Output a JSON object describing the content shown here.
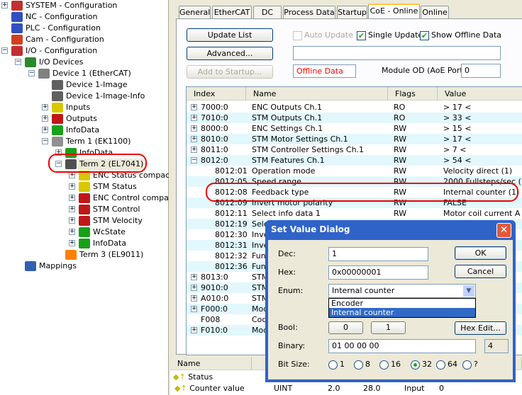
{
  "tree": [
    {
      "label": "SYSTEM - Configuration",
      "level": 0,
      "expander": "+",
      "icon": "system-icon"
    },
    {
      "label": "NC - Configuration",
      "level": 0,
      "expander": "",
      "icon": "nc-icon"
    },
    {
      "label": "PLC - Configuration",
      "level": 0,
      "expander": "",
      "icon": "plc-icon"
    },
    {
      "label": "Cam - Configuration",
      "level": 0,
      "expander": "",
      "icon": "cam-icon"
    },
    {
      "label": "I/O - Configuration",
      "level": 0,
      "expander": "-",
      "icon": "io-icon"
    },
    {
      "label": "I/O Devices",
      "level": 1,
      "expander": "-",
      "icon": "io-devices-icon"
    },
    {
      "label": "Device 1 (EtherCAT)",
      "level": 2,
      "expander": "-",
      "icon": "ethercat-device-icon"
    },
    {
      "label": "Device 1-Image",
      "level": 3,
      "expander": "",
      "icon": "image-icon"
    },
    {
      "label": "Device 1-Image-Info",
      "level": 3,
      "expander": "",
      "icon": "image-icon"
    },
    {
      "label": "Inputs",
      "level": 3,
      "expander": "+",
      "icon": "inputs-icon"
    },
    {
      "label": "Outputs",
      "level": 3,
      "expander": "+",
      "icon": "outputs-icon"
    },
    {
      "label": "InfoData",
      "level": 3,
      "expander": "+",
      "icon": "infodata-icon"
    },
    {
      "label": "Term 1 (EK1100)",
      "level": 3,
      "expander": "-",
      "icon": "coupler-icon"
    },
    {
      "label": "InfoData",
      "level": 4,
      "expander": "+",
      "icon": "infodata-icon"
    },
    {
      "label": "Term 2 (EL7041)",
      "level": 4,
      "expander": "-",
      "icon": "terminal-icon",
      "selected": true
    },
    {
      "label": "ENC Status compact",
      "level": 5,
      "expander": "+",
      "icon": "inputs-icon"
    },
    {
      "label": "STM Status",
      "level": 5,
      "expander": "+",
      "icon": "inputs-icon"
    },
    {
      "label": "ENC Control compact",
      "level": 5,
      "expander": "+",
      "icon": "outputs-icon"
    },
    {
      "label": "STM Control",
      "level": 5,
      "expander": "+",
      "icon": "outputs-icon"
    },
    {
      "label": "STM Velocity",
      "level": 5,
      "expander": "+",
      "icon": "outputs-icon"
    },
    {
      "label": "WcState",
      "level": 5,
      "expander": "+",
      "icon": "infodata-icon"
    },
    {
      "label": "InfoData",
      "level": 5,
      "expander": "+",
      "icon": "infodata-icon"
    },
    {
      "label": "Term 3 (EL9011)",
      "level": 4,
      "expander": "",
      "icon": "end-terminal-icon"
    },
    {
      "label": "Mappings",
      "level": 1,
      "expander": "",
      "icon": "mappings-icon"
    }
  ],
  "tabs": [
    "General",
    "EtherCAT",
    "DC",
    "Process Data",
    "Startup",
    "CoE - Online",
    "Online"
  ],
  "active_tab": "CoE - Online",
  "toolbar": {
    "update_list": "Update List",
    "advanced": "Advanced...",
    "add_to_startup": "Add to Startup...",
    "auto_update": "Auto Update",
    "auto_update_checked": false,
    "single_update": "Single Update",
    "single_update_checked": true,
    "show_offline": "Show Offline Data",
    "show_offline_checked": true,
    "offline_data": "Offline Data",
    "module_od_label": "Module OD (AoE Port):",
    "module_od_value": "0"
  },
  "list": {
    "headers": [
      "Index",
      "Name",
      "Flags",
      "Value"
    ],
    "rows": [
      {
        "exp": "+",
        "index": "7000:0",
        "name": "ENC Outputs Ch.1",
        "flags": "RO",
        "value": "> 17 <"
      },
      {
        "exp": "+",
        "index": "7010:0",
        "name": "STM Outputs Ch.1",
        "flags": "RO",
        "value": "> 33 <"
      },
      {
        "exp": "+",
        "index": "8000:0",
        "name": "ENC Settings Ch.1",
        "flags": "RW",
        "value": "> 15 <"
      },
      {
        "exp": "+",
        "index": "8010:0",
        "name": "STM Motor Settings Ch.1",
        "flags": "RW",
        "value": "> 17 <"
      },
      {
        "exp": "+",
        "index": "8011:0",
        "name": "STM Controller Settings Ch.1",
        "flags": "RW",
        "value": "> 7 <"
      },
      {
        "exp": "-",
        "index": "8012:0",
        "name": "STM Features Ch.1",
        "flags": "RW",
        "value": "> 54 <"
      },
      {
        "exp": "",
        "sub": true,
        "index": "8012:01",
        "name": "Operation mode",
        "flags": "RW",
        "value": "Velocity direct (1)"
      },
      {
        "exp": "",
        "sub": true,
        "index": "8012:05",
        "name": "Speed range",
        "flags": "RW",
        "value": "2000 Fullsteps/sec (1)"
      },
      {
        "exp": "",
        "sub": true,
        "index": "8012:08",
        "name": "Feedback type",
        "flags": "RW",
        "value": "Internal counter (1)"
      },
      {
        "exp": "",
        "sub": true,
        "index": "8012:09",
        "name": "Invert motor polarity",
        "flags": "RW",
        "value": "FALSE"
      },
      {
        "exp": "",
        "sub": true,
        "index": "8012:11",
        "name": "Select info data 1",
        "flags": "RW",
        "value": "Motor coil current A (3)"
      },
      {
        "exp": "",
        "sub": true,
        "index": "8012:19",
        "name": "Sele",
        "flags": "",
        "value": ""
      },
      {
        "exp": "",
        "sub": true,
        "index": "8012:30",
        "name": "Inve",
        "flags": "",
        "value": ""
      },
      {
        "exp": "",
        "sub": true,
        "index": "8012:31",
        "name": "Inve",
        "flags": "",
        "value": ""
      },
      {
        "exp": "",
        "sub": true,
        "index": "8012:32",
        "name": "Func",
        "flags": "",
        "value": ""
      },
      {
        "exp": "",
        "sub": true,
        "index": "8012:36",
        "name": "Func",
        "flags": "",
        "value": ""
      },
      {
        "exp": "+",
        "index": "8013:0",
        "name": "STM",
        "flags": "",
        "value": ""
      },
      {
        "exp": "+",
        "index": "9010:0",
        "name": "STM",
        "flags": "",
        "value": ""
      },
      {
        "exp": "+",
        "index": "A010:0",
        "name": "STM",
        "flags": "",
        "value": ""
      },
      {
        "exp": "+",
        "index": "F000:0",
        "name": "Mod",
        "flags": "",
        "value": ""
      },
      {
        "exp": "",
        "index": "F008",
        "name": "Cod",
        "flags": "",
        "value": ""
      },
      {
        "exp": "+",
        "index": "F010:0",
        "name": "Mod",
        "flags": "",
        "value": ""
      }
    ]
  },
  "bottom": {
    "header_name": "Name",
    "rows": [
      {
        "name": "Status",
        "type": "",
        "size": "",
        "offset": "",
        "io": "",
        "value": ""
      },
      {
        "name": "Counter value",
        "type": "UINT",
        "size": "2.0",
        "offset": "28.0",
        "io": "Input",
        "value": "0"
      }
    ]
  },
  "dialog": {
    "title": "Set Value Dialog",
    "close": "✕",
    "dec_label": "Dec:",
    "dec_value": "1",
    "hex_label": "Hex:",
    "hex_value": "0x00000001",
    "enum_label": "Enum:",
    "enum_value": "Internal counter",
    "enum_options": [
      "Encoder",
      "Internal counter"
    ],
    "bool_label": "Bool:",
    "bool_0": "0",
    "bool_1": "1",
    "binary_label": "Binary:",
    "binary_value": "01 00 00 00",
    "byte_count": "4",
    "bitsize_label": "Bit Size:",
    "bitsizes": [
      "1",
      "8",
      "16",
      "32",
      "64",
      "?"
    ],
    "bitsize_selected": "32",
    "ok": "OK",
    "cancel": "Cancel",
    "hex_edit": "Hex Edit..."
  },
  "colors": {
    "accent": "#2f63c8",
    "offline": "#ff0000",
    "highlight_ring": "#e00000",
    "row_alt": "#e2f8fc"
  }
}
